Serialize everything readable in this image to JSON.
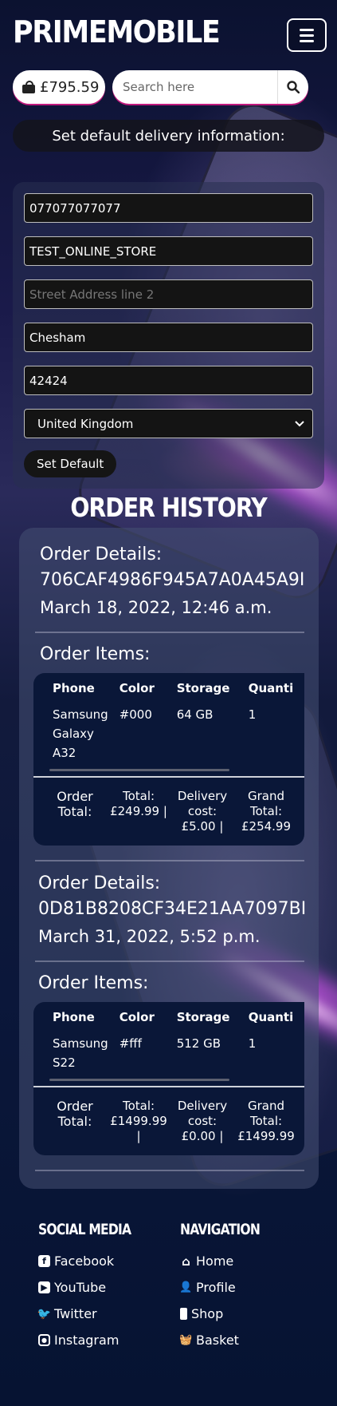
{
  "header": {
    "brand": "PRIMEMOBILE",
    "menu_icon": "hamburger-menu-icon"
  },
  "toolbar": {
    "basket_total": "£795.59",
    "basket_icon": "shopping-bag-icon",
    "search_placeholder": "Search here",
    "search_icon": "magnifier-icon"
  },
  "delivery": {
    "title": "Set default delivery information:",
    "phone": "077077077077",
    "address_line1": "TEST_ONLINE_STORE",
    "address_line2_placeholder": "Street Address line 2",
    "town": "Chesham",
    "postcode": "42424",
    "country": "United Kingdom",
    "submit_label": "Set Default"
  },
  "order_history": {
    "heading": "ORDER HISTORY",
    "details_label": "Order Details:",
    "items_label": "Order Items:",
    "columns": [
      "Phone",
      "Color",
      "Storage",
      "Quanti"
    ],
    "orders": [
      {
        "id": "706CAF4986F945A7A0A45A9I",
        "date": "March 18, 2022, 12:46 a.m.",
        "items": [
          {
            "phone": "Samsung Galaxy A32",
            "color": "#000",
            "storage": "64 GB",
            "quantity": "1"
          }
        ],
        "order_total_label": "Order Total:",
        "total_line": "Total: £249.99 |",
        "delivery_line": "Delivery cost: £5.00 |",
        "grand_total_line": "Grand Total: £254.99"
      },
      {
        "id": "0D81B8208CF34E21AA7097BI",
        "date": "March 31, 2022, 5:52 p.m.",
        "items": [
          {
            "phone": "Samsung S22",
            "color": "#fff",
            "storage": "512 GB",
            "quantity": "1"
          }
        ],
        "order_total_label": "Order Total:",
        "total_line": "Total: £1499.99 |",
        "delivery_line": "Delivery cost: £0.00 |",
        "grand_total_line": "Grand Total: £1499.99"
      }
    ]
  },
  "footer": {
    "social_heading": "SOCIAL MEDIA",
    "social_links": [
      "Facebook",
      "YouTube",
      "Twitter",
      "Instagram"
    ],
    "nav_heading": "NAVIGATION",
    "nav_links": [
      "Home",
      "Profile",
      "Shop",
      "Basket"
    ]
  },
  "colors": {
    "background": "#06122d",
    "accent_shadow": "#c21a7e",
    "input_bg": "#141414",
    "items_card_bg": "#0a1738"
  }
}
